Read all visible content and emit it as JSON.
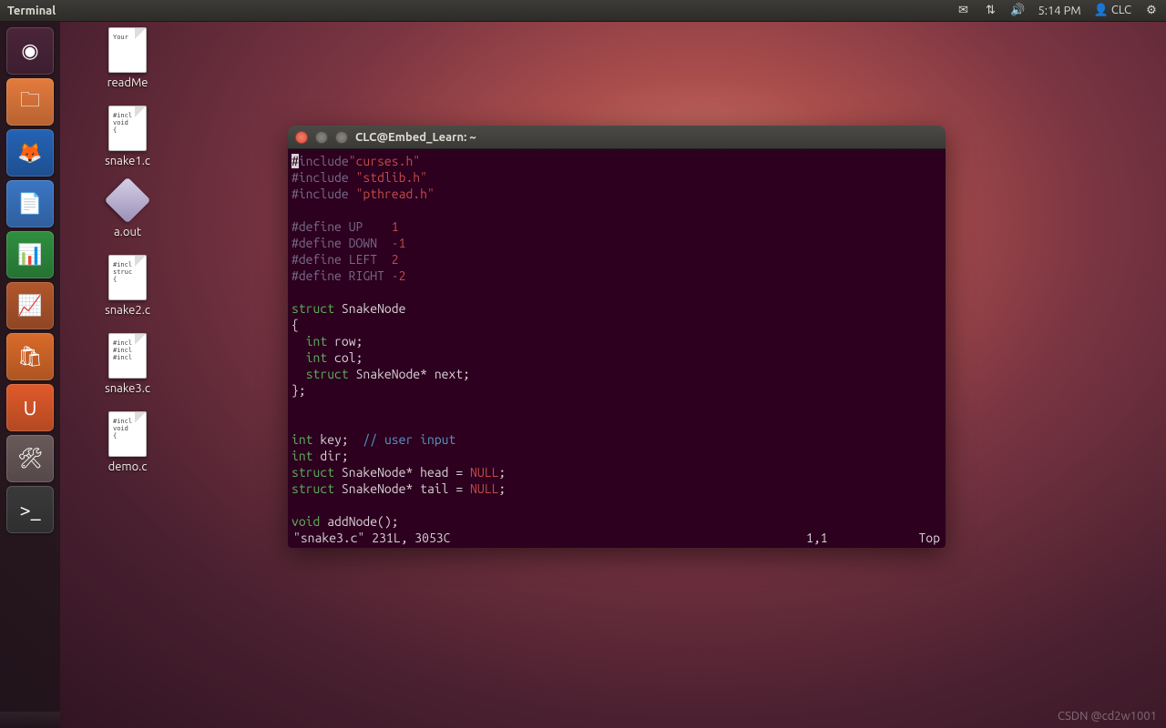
{
  "panel": {
    "app_title": "Terminal",
    "time": "5:14 PM",
    "user": "CLC"
  },
  "launcher": {
    "items": [
      {
        "name": "dash",
        "color": "#4b253a",
        "glyph": "◉"
      },
      {
        "name": "nautilus",
        "color": "#e47b3d",
        "glyph": "🗀"
      },
      {
        "name": "firefox",
        "color": "#2563b5",
        "glyph": "🦊"
      },
      {
        "name": "writer",
        "color": "#3b76c4",
        "glyph": "📄"
      },
      {
        "name": "calc",
        "color": "#2f8f3f",
        "glyph": "📊"
      },
      {
        "name": "impress",
        "color": "#b2572c",
        "glyph": "📈"
      },
      {
        "name": "software",
        "color": "#d96a2a",
        "glyph": "🛍"
      },
      {
        "name": "ubuntuone",
        "color": "#e05a2a",
        "glyph": "U"
      },
      {
        "name": "settings",
        "color": "#6a5a5a",
        "glyph": "🛠"
      },
      {
        "name": "terminal",
        "color": "#3a3a3a",
        "glyph": ">_"
      }
    ]
  },
  "desktop": {
    "icons": [
      {
        "label": "readMe",
        "type": "doc",
        "preview": "Your"
      },
      {
        "label": "snake1.c",
        "type": "doc",
        "preview": "#incl\nvoid\n{"
      },
      {
        "label": "a.out",
        "type": "diamond",
        "preview": ""
      },
      {
        "label": "snake2.c",
        "type": "doc",
        "preview": "#incl\nstruc\n{"
      },
      {
        "label": "snake3.c",
        "type": "doc",
        "preview": "#incl\n#incl\n#incl"
      },
      {
        "label": "demo.c",
        "type": "doc",
        "preview": "#incl\nvoid\n{"
      }
    ]
  },
  "terminal": {
    "title": "CLC@Embed_Learn: ~",
    "code": [
      [
        {
          "c": "cursor",
          "t": "#"
        },
        {
          "c": "prep",
          "t": "include"
        },
        {
          "c": "str",
          "t": "\"curses.h\""
        }
      ],
      [
        {
          "c": "prep",
          "t": "#include "
        },
        {
          "c": "str",
          "t": "\"stdlib.h\""
        }
      ],
      [
        {
          "c": "prep",
          "t": "#include "
        },
        {
          "c": "str",
          "t": "\"pthread.h\""
        }
      ],
      [],
      [
        {
          "c": "prep",
          "t": "#define UP    "
        },
        {
          "c": "num",
          "t": "1"
        }
      ],
      [
        {
          "c": "prep",
          "t": "#define DOWN  "
        },
        {
          "c": "num",
          "t": "-1"
        }
      ],
      [
        {
          "c": "prep",
          "t": "#define LEFT  "
        },
        {
          "c": "num",
          "t": "2"
        }
      ],
      [
        {
          "c": "prep",
          "t": "#define RIGHT "
        },
        {
          "c": "num",
          "t": "-2"
        }
      ],
      [],
      [
        {
          "c": "kw",
          "t": "struct"
        },
        {
          "c": "pl",
          "t": " SnakeNode"
        }
      ],
      [
        {
          "c": "pl",
          "t": "{"
        }
      ],
      [
        {
          "c": "pl",
          "t": "  "
        },
        {
          "c": "type",
          "t": "int"
        },
        {
          "c": "pl",
          "t": " row;"
        }
      ],
      [
        {
          "c": "pl",
          "t": "  "
        },
        {
          "c": "type",
          "t": "int"
        },
        {
          "c": "pl",
          "t": " col;"
        }
      ],
      [
        {
          "c": "pl",
          "t": "  "
        },
        {
          "c": "kw",
          "t": "struct"
        },
        {
          "c": "pl",
          "t": " SnakeNode* next;"
        }
      ],
      [
        {
          "c": "pl",
          "t": "};"
        }
      ],
      [],
      [],
      [
        {
          "c": "type",
          "t": "int"
        },
        {
          "c": "pl",
          "t": " key;  "
        },
        {
          "c": "com",
          "t": "// user input"
        }
      ],
      [
        {
          "c": "type",
          "t": "int"
        },
        {
          "c": "pl",
          "t": " dir;"
        }
      ],
      [
        {
          "c": "kw",
          "t": "struct"
        },
        {
          "c": "pl",
          "t": " SnakeNode* head = "
        },
        {
          "c": "const",
          "t": "NULL"
        },
        {
          "c": "pl",
          "t": ";"
        }
      ],
      [
        {
          "c": "kw",
          "t": "struct"
        },
        {
          "c": "pl",
          "t": " SnakeNode* tail = "
        },
        {
          "c": "const",
          "t": "NULL"
        },
        {
          "c": "pl",
          "t": ";"
        }
      ],
      [],
      [
        {
          "c": "type",
          "t": "void"
        },
        {
          "c": "pl",
          "t": " addNode();"
        }
      ]
    ],
    "status": {
      "file": "\"snake3.c\" 231L, 3053C",
      "pos": "1,1",
      "scroll": "Top"
    }
  },
  "watermark": "CSDN @cd2w1001"
}
